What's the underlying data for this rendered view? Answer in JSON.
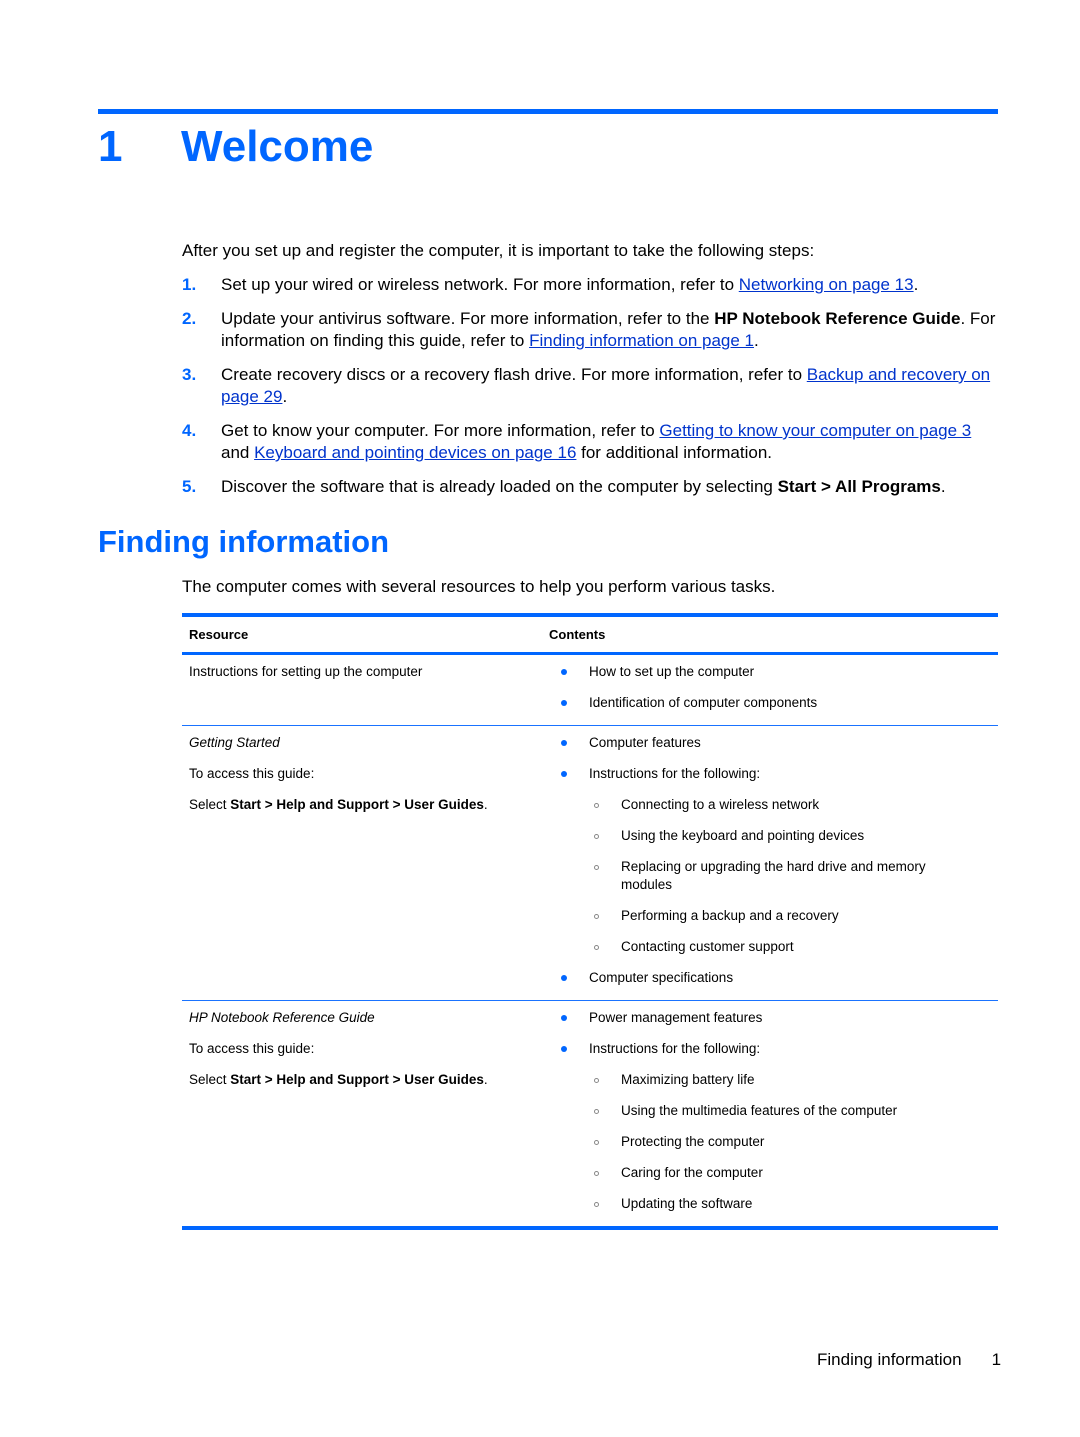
{
  "chapter": {
    "number": "1",
    "title": "Welcome"
  },
  "intro": "After you set up and register the computer, it is important to take the following steps:",
  "steps": [
    {
      "n": "1.",
      "t1": "Set up your wired or wireless network. For more information, refer to ",
      "link1": "Networking on page 13",
      "t2": "."
    },
    {
      "n": "2.",
      "t1": "Update your antivirus software. For more information, refer to the ",
      "bold1": "HP Notebook Reference Guide",
      "t2": ". For information on finding this guide, refer to ",
      "link1": "Finding information on page 1",
      "t3": "."
    },
    {
      "n": "3.",
      "t1": "Create recovery discs or a recovery flash drive. For more information, refer to ",
      "link1": "Backup and recovery on page 29",
      "t2": "."
    },
    {
      "n": "4.",
      "t1": "Get to know your computer. For more information, refer to ",
      "link1": "Getting to know your computer on page 3",
      "t2": " and ",
      "link2": "Keyboard and pointing devices on page 16",
      "t3": " for additional information."
    },
    {
      "n": "5.",
      "t1": "Discover the software that is already loaded on the computer by selecting ",
      "bold1": "Start > All Programs",
      "t2": "."
    }
  ],
  "section": {
    "title": "Finding information",
    "intro": "The computer comes with several resources to help you perform various tasks."
  },
  "table": {
    "headers": {
      "resource": "Resource",
      "contents": "Contents"
    },
    "rows": [
      {
        "resource": {
          "title": "Instructions for setting up the computer"
        },
        "items": [
          {
            "level": 1,
            "text": "How to set up the computer"
          },
          {
            "level": 1,
            "text": "Identification of computer components"
          }
        ]
      },
      {
        "resource": {
          "title": "Getting Started",
          "access": "To access this guide:",
          "select_prefix": "Select ",
          "select_path": "Start > Help and Support > User Guides",
          "select_suffix": "."
        },
        "items": [
          {
            "level": 1,
            "text": "Computer features"
          },
          {
            "level": 1,
            "text": "Instructions for the following:"
          },
          {
            "level": 2,
            "text": "Connecting to a wireless network"
          },
          {
            "level": 2,
            "text": "Using the keyboard and pointing devices"
          },
          {
            "level": 2,
            "text": "Replacing or upgrading the hard drive and memory modules"
          },
          {
            "level": 2,
            "text": "Performing a backup and a recovery"
          },
          {
            "level": 2,
            "text": "Contacting customer support"
          },
          {
            "level": 1,
            "text": "Computer specifications"
          }
        ]
      },
      {
        "resource": {
          "title": "HP Notebook Reference Guide",
          "access": "To access this guide:",
          "select_prefix": "Select ",
          "select_path": "Start > Help and Support > User Guides",
          "select_suffix": "."
        },
        "items": [
          {
            "level": 1,
            "text": "Power management features"
          },
          {
            "level": 1,
            "text": "Instructions for the following:"
          },
          {
            "level": 2,
            "text": "Maximizing battery life"
          },
          {
            "level": 2,
            "text": "Using the multimedia features of the computer"
          },
          {
            "level": 2,
            "text": "Protecting the computer"
          },
          {
            "level": 2,
            "text": "Caring for the computer"
          },
          {
            "level": 2,
            "text": "Updating the software"
          }
        ]
      }
    ]
  },
  "footer": {
    "section": "Finding information",
    "page": "1"
  },
  "colors": {
    "accent": "#0066ff",
    "link": "#0033cc"
  }
}
